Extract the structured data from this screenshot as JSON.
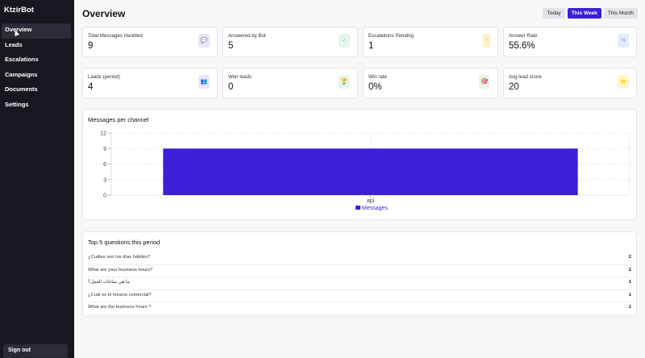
{
  "sidebar": {
    "brand": "KtzirBot",
    "items": [
      {
        "label": "Overview",
        "active": true
      },
      {
        "label": "Leads"
      },
      {
        "label": "Escalations"
      },
      {
        "label": "Campaigns"
      },
      {
        "label": "Documents"
      },
      {
        "label": "Settings"
      }
    ],
    "sign_out": "Sign out"
  },
  "header": {
    "title": "Overview",
    "range_options": [
      "Today",
      "This Week",
      "This Month"
    ],
    "selected_range": "This Week"
  },
  "stats": [
    {
      "label": "Total Messages Handled",
      "value": "9",
      "icon": "chat-icon",
      "color": "#e6e6fa"
    },
    {
      "label": "Answered by Bot",
      "value": "5",
      "icon": "check-icon",
      "color": "#e3f8e8"
    },
    {
      "label": "Escalations Pending",
      "value": "1",
      "icon": "alert-icon",
      "color": "#fdf1cc"
    },
    {
      "label": "Answer Rate",
      "value": "55.6%",
      "icon": "percent-icon",
      "color": "#e4ebfb"
    },
    {
      "label": "Leads (period)",
      "value": "4",
      "icon": "people-icon",
      "color": "#efe4fb"
    },
    {
      "label": "Won leads",
      "value": "0",
      "icon": "trophy-icon",
      "color": "#e3f7e6"
    },
    {
      "label": "Win rate",
      "value": "0%",
      "icon": "target-icon",
      "color": "#e3f7e6"
    },
    {
      "label": "Avg lead score",
      "value": "20",
      "icon": "star-icon",
      "color": "#fdf7c8"
    }
  ],
  "chart_card": {
    "title": "Messages per channel"
  },
  "chart_data": {
    "type": "bar",
    "title": "Messages per channel",
    "categories": [
      "api"
    ],
    "series": [
      {
        "name": "Messages",
        "values": [
          9
        ],
        "color": "#3c1fd6"
      }
    ],
    "yticks": [
      "0",
      "3",
      "6",
      "9",
      "12"
    ],
    "ylim": [
      0,
      12
    ],
    "grid": true,
    "legend": "bottom"
  },
  "questions": {
    "title": "Top 5 questions this period",
    "items": [
      {
        "text": "¿Cuáles son los días hábiles?",
        "count": "2"
      },
      {
        "text": "What are your business hours?",
        "count": "2"
      },
      {
        "text": "ما هي ساعات العمل؟",
        "count": "1"
      },
      {
        "text": "¿Cuál es el horario comercial?",
        "count": "1"
      },
      {
        "text": "What are the business hours ?",
        "count": "1"
      }
    ]
  }
}
